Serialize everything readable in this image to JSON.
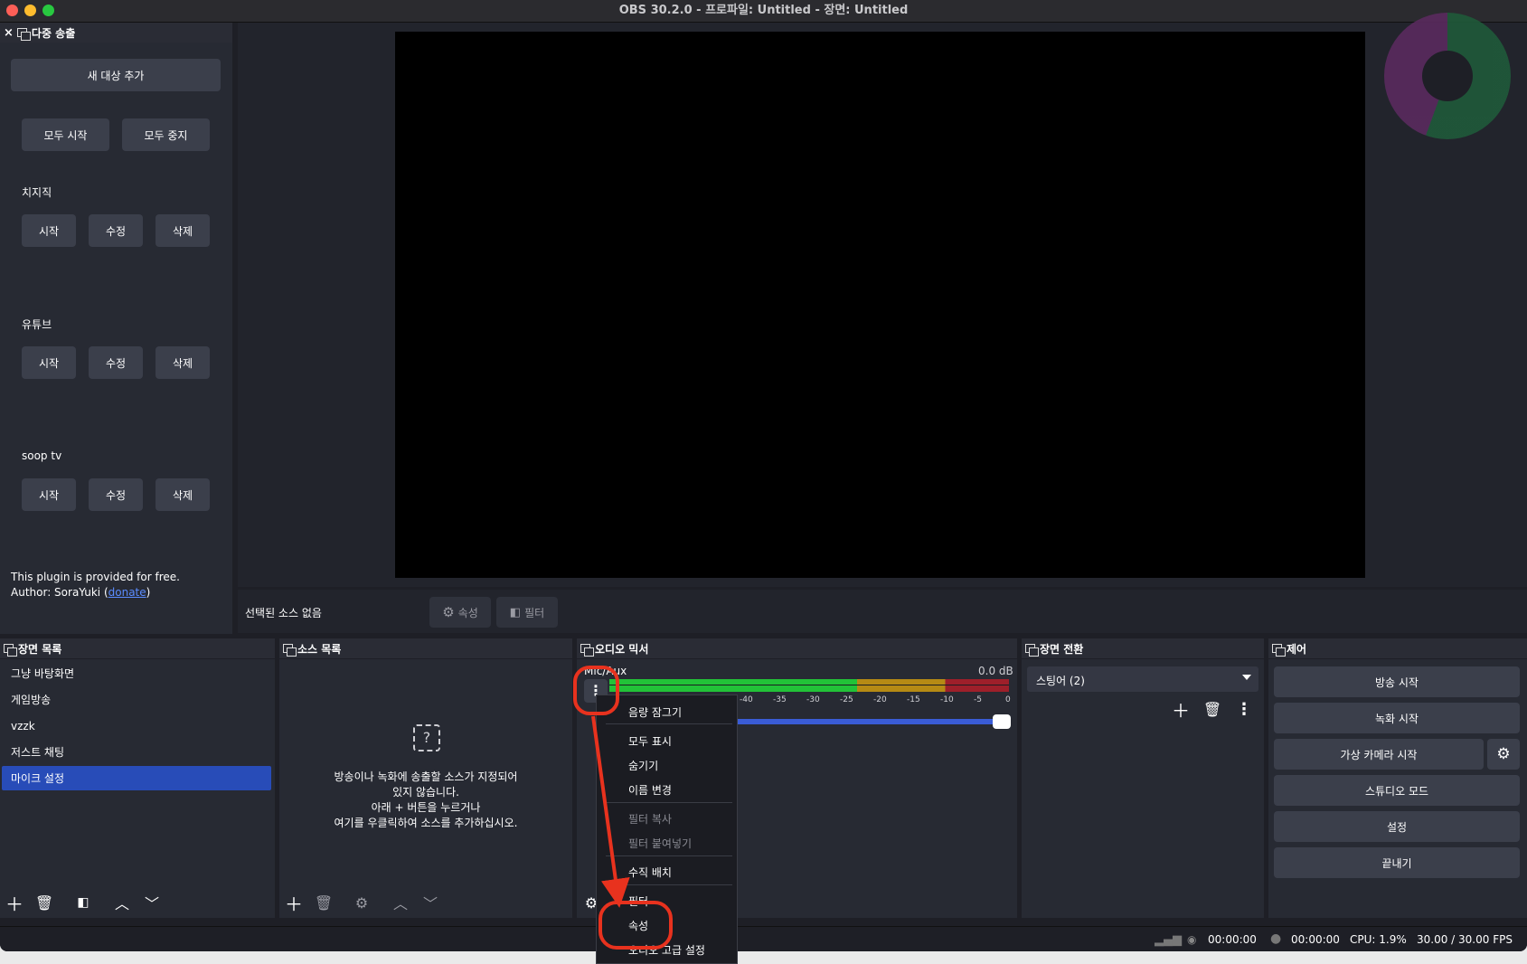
{
  "window": {
    "title": "OBS 30.2.0 - 프로파일: Untitled - 장면: Untitled"
  },
  "multistream": {
    "title": "다중 송출",
    "close": "×",
    "add_target": "새 대상 추가",
    "start_all": "모두 시작",
    "stop_all": "모두 중지",
    "targets": [
      {
        "name": "치지직",
        "start": "시작",
        "edit": "수정",
        "delete": "삭제"
      },
      {
        "name": "유튜브",
        "start": "시작",
        "edit": "수정",
        "delete": "삭제"
      },
      {
        "name": "soop tv",
        "start": "시작",
        "edit": "수정",
        "delete": "삭제"
      }
    ],
    "footer_line1": "This plugin is provided for free.",
    "footer_author_prefix": "Author: SoraYuki (",
    "footer_donate": "donate",
    "footer_author_suffix": ")"
  },
  "source_bar": {
    "no_source": "선택된 소스 없음",
    "properties": "속성",
    "filters": "필터"
  },
  "scenes": {
    "title": "장면 목록",
    "items": [
      "그냥 바탕화면",
      "게임방송",
      "vzzk",
      "저스트 채팅",
      "마이크 설정"
    ],
    "selected_index": 4
  },
  "sources": {
    "title": "소스 목록",
    "empty_line1": "방송이나 녹화에 송출할 소스가 지정되어",
    "empty_line2": "있지 않습니다.",
    "empty_line3": "아래 + 버튼을 누르거나",
    "empty_line4": "여기를 우클릭하여 소스를 추가하십시오."
  },
  "mixer": {
    "title": "오디오 믹서",
    "track_name": "Mic/Aux",
    "db": "0.0 dB",
    "scale": [
      "-40",
      "-35",
      "-30",
      "-25",
      "-20",
      "-15",
      "-10",
      "-5",
      "0"
    ],
    "volume_level": 1.0
  },
  "context_menu": {
    "items": [
      "음량 잠그기",
      "모두 표시",
      "숨기기",
      "이름 변경",
      "필터 복사",
      "필터 붙여넣기",
      "수직 배치",
      "필터",
      "속성",
      "오디오 고급 설정"
    ],
    "highlighted": "속성",
    "highlight_color": "#e8321e"
  },
  "transitions": {
    "title": "장면 전환",
    "selected": "스팅어 (2)"
  },
  "controls": {
    "title": "제어",
    "start_stream": "방송 시작",
    "start_record": "녹화 시작",
    "virtual_camera": "가상 카메라 시작",
    "studio_mode": "스튜디오 모드",
    "settings": "설정",
    "exit": "끝내기"
  },
  "status_bar": {
    "stream_time": "00:00:00",
    "record_time": "00:00:00",
    "cpu": "CPU: 1.9%",
    "fps": "30.00 / 30.00 FPS"
  }
}
